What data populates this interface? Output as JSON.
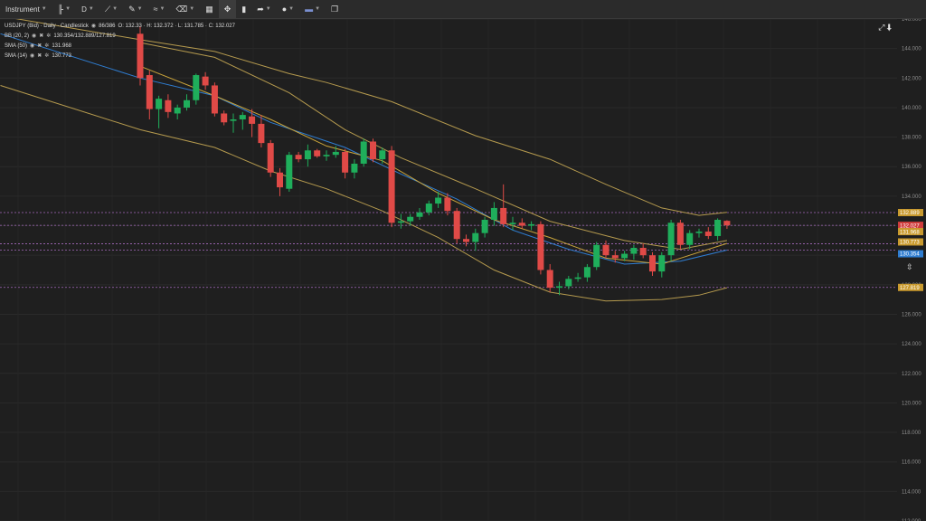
{
  "toolbar": {
    "instrument_label": "Instrument",
    "timeframe_label": "D",
    "flag_icon": "uk-flag-icon"
  },
  "legend": {
    "title": "USDJPY (Bid) · Daily · Candlestick",
    "counter": "86/386",
    "ohlc": "O: 132.33 · H: 132.372 · L: 131.785 · C: 132.027",
    "bb_label": "BB (20, 2)",
    "bb_values": "130.354/132.889/127.819",
    "sma50_label": "SMA (50)",
    "sma50_value": "131.968",
    "sma14_label": "SMA (14)",
    "sma14_value": "130.773"
  },
  "colors": {
    "up": "#1fae5b",
    "down": "#e04a47",
    "bollinger": "#b59a4e",
    "sma50": "#2f7dd1",
    "sma14": "#c9a43b",
    "hline": "#a569bd",
    "tag_bb": "#c99a2e",
    "tag_price": "#d03c3c",
    "tag_sma50": "#2f7dd1"
  },
  "chart_data": {
    "type": "candlestick",
    "title": "USDJPY (Bid) · Daily · Candlestick",
    "ylim": [
      112,
      146
    ],
    "y_ticks": [
      "146.000",
      "144.000",
      "142.000",
      "140.000",
      "138.000",
      "136.000",
      "134.000",
      "132.000",
      "130.000",
      "128.000",
      "126.000",
      "124.000",
      "122.000",
      "120.000",
      "118.000",
      "116.000",
      "114.000",
      "112.000"
    ],
    "grid": true,
    "candles": [
      [
        145.0,
        145.5,
        141.5,
        142.0
      ],
      [
        142.2,
        142.5,
        139.2,
        139.9
      ],
      [
        139.9,
        140.8,
        138.6,
        140.6
      ],
      [
        140.5,
        140.9,
        139.3,
        139.7
      ],
      [
        139.6,
        140.2,
        139.2,
        140.0
      ],
      [
        140.0,
        140.9,
        139.8,
        140.5
      ],
      [
        140.5,
        142.3,
        140.2,
        142.2
      ],
      [
        142.1,
        142.4,
        141.2,
        141.5
      ],
      [
        141.5,
        141.7,
        139.4,
        139.6
      ],
      [
        139.6,
        139.8,
        138.8,
        139.0
      ],
      [
        139.1,
        139.6,
        138.3,
        139.2
      ],
      [
        139.2,
        139.7,
        138.5,
        139.5
      ],
      [
        139.4,
        139.9,
        138.0,
        138.9
      ],
      [
        138.9,
        139.5,
        137.3,
        137.6
      ],
      [
        137.6,
        137.8,
        135.3,
        135.6
      ],
      [
        135.6,
        135.9,
        134.0,
        134.6
      ],
      [
        134.5,
        137.0,
        134.3,
        136.8
      ],
      [
        136.8,
        137.0,
        136.3,
        136.5
      ],
      [
        136.5,
        137.5,
        136.0,
        137.1
      ],
      [
        137.1,
        137.2,
        136.6,
        136.7
      ],
      [
        136.7,
        137.1,
        136.4,
        136.8
      ],
      [
        136.8,
        137.4,
        136.6,
        137.0
      ],
      [
        137.0,
        137.2,
        135.2,
        135.6
      ],
      [
        135.6,
        136.5,
        135.2,
        136.2
      ],
      [
        136.2,
        137.9,
        136.0,
        137.7
      ],
      [
        137.7,
        137.9,
        136.3,
        136.5
      ],
      [
        136.5,
        137.3,
        136.2,
        137.1
      ],
      [
        137.1,
        137.4,
        131.9,
        132.2
      ],
      [
        132.2,
        132.8,
        131.8,
        132.3
      ],
      [
        132.3,
        132.8,
        132.0,
        132.6
      ],
      [
        132.6,
        133.2,
        132.4,
        132.9
      ],
      [
        132.9,
        133.7,
        132.7,
        133.5
      ],
      [
        133.5,
        134.3,
        133.2,
        133.9
      ],
      [
        133.9,
        134.2,
        132.7,
        133.0
      ],
      [
        133.0,
        133.2,
        130.8,
        131.1
      ],
      [
        131.1,
        131.4,
        130.6,
        130.9
      ],
      [
        130.9,
        131.8,
        130.3,
        131.5
      ],
      [
        131.5,
        132.6,
        131.2,
        132.4
      ],
      [
        132.4,
        133.6,
        132.0,
        133.2
      ],
      [
        133.2,
        134.8,
        131.9,
        132.1
      ],
      [
        132.1,
        132.6,
        131.7,
        132.2
      ],
      [
        132.2,
        132.5,
        131.8,
        132.0
      ],
      [
        132.0,
        132.3,
        131.7,
        132.1
      ],
      [
        132.1,
        132.3,
        128.7,
        129.0
      ],
      [
        129.0,
        129.4,
        127.5,
        127.8
      ],
      [
        127.8,
        128.2,
        127.3,
        127.9
      ],
      [
        127.9,
        128.6,
        127.7,
        128.4
      ],
      [
        128.4,
        128.8,
        128.2,
        128.5
      ],
      [
        128.5,
        129.4,
        128.2,
        129.2
      ],
      [
        129.2,
        130.9,
        129.0,
        130.7
      ],
      [
        130.7,
        131.0,
        129.8,
        130.0
      ],
      [
        130.0,
        130.3,
        129.5,
        129.8
      ],
      [
        129.8,
        130.3,
        129.6,
        130.1
      ],
      [
        130.1,
        130.7,
        129.7,
        130.5
      ],
      [
        130.5,
        130.8,
        129.8,
        130.0
      ],
      [
        130.0,
        130.2,
        128.6,
        128.9
      ],
      [
        128.9,
        130.2,
        128.5,
        130.0
      ],
      [
        130.0,
        132.4,
        129.6,
        132.2
      ],
      [
        132.2,
        132.4,
        130.4,
        130.7
      ],
      [
        130.7,
        131.7,
        130.4,
        131.5
      ],
      [
        131.5,
        131.8,
        131.2,
        131.6
      ],
      [
        131.6,
        131.9,
        131.1,
        131.3
      ],
      [
        131.3,
        132.5,
        131.0,
        132.4
      ],
      [
        132.33,
        132.372,
        131.785,
        132.027
      ]
    ],
    "bollinger_upper": [
      [
        0,
        144.6
      ],
      [
        8,
        143.8
      ],
      [
        16,
        142.3
      ],
      [
        20,
        141.7
      ],
      [
        27,
        140.4
      ],
      [
        36,
        138.1
      ],
      [
        44,
        136.5
      ],
      [
        50,
        134.8
      ],
      [
        56,
        133.2
      ],
      [
        60,
        132.7
      ],
      [
        63,
        132.9
      ]
    ],
    "bollinger_middle": [
      [
        0,
        142.0
      ],
      [
        8,
        140.8
      ],
      [
        14,
        139.0
      ],
      [
        22,
        137.3
      ],
      [
        28,
        135.5
      ],
      [
        34,
        133.8
      ],
      [
        40,
        131.7
      ],
      [
        46,
        130.4
      ],
      [
        52,
        129.4
      ],
      [
        58,
        129.6
      ],
      [
        63,
        130.35
      ]
    ],
    "bollinger_lower": [
      [
        0,
        138.5
      ],
      [
        8,
        137.3
      ],
      [
        14,
        135.7
      ],
      [
        20,
        134.5
      ],
      [
        26,
        133.0
      ],
      [
        32,
        131.2
      ],
      [
        38,
        129.0
      ],
      [
        44,
        127.5
      ],
      [
        50,
        126.9
      ],
      [
        56,
        127.0
      ],
      [
        60,
        127.3
      ],
      [
        63,
        127.8
      ]
    ],
    "sma50": [
      [
        0,
        144.4
      ],
      [
        8,
        143.4
      ],
      [
        16,
        141.0
      ],
      [
        22,
        138.5
      ],
      [
        28,
        136.6
      ],
      [
        36,
        134.5
      ],
      [
        44,
        132.3
      ],
      [
        52,
        131.0
      ],
      [
        58,
        130.4
      ],
      [
        63,
        131.0
      ]
    ],
    "sma14": [
      [
        0,
        142.8
      ],
      [
        8,
        140.8
      ],
      [
        14,
        139.2
      ],
      [
        20,
        137.4
      ],
      [
        26,
        136.4
      ],
      [
        32,
        134.2
      ],
      [
        38,
        132.4
      ],
      [
        44,
        131.2
      ],
      [
        50,
        129.8
      ],
      [
        56,
        129.4
      ],
      [
        63,
        130.8
      ]
    ],
    "horizontal_lines": [
      132.889,
      132.027,
      130.773,
      130.354,
      127.819
    ],
    "price_tags": [
      {
        "value": "132.889",
        "color": "#c99a2e",
        "y": 132.889
      },
      {
        "value": "132.027",
        "color": "#d03c3c",
        "y": 132.027
      },
      {
        "value": "131.968",
        "color": "#c99a2e",
        "y": 131.6
      },
      {
        "value": "130.773",
        "color": "#c99a2e",
        "y": 130.9
      },
      {
        "value": "130.354",
        "color": "#2f7dd1",
        "y": 130.1
      },
      {
        "value": "127.819",
        "color": "#c99a2e",
        "y": 127.819
      }
    ]
  }
}
